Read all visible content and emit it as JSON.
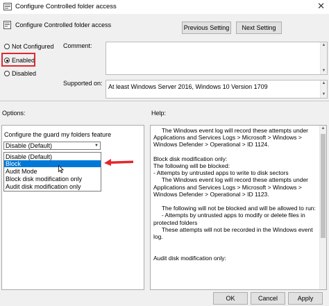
{
  "window": {
    "title": "Configure Controlled folder access",
    "close_glyph": "✕"
  },
  "header": {
    "policy_title": "Configure Controlled folder access",
    "prev_button": "Previous Setting",
    "next_button": "Next Setting"
  },
  "state": {
    "not_configured": "Not Configured",
    "enabled": "Enabled",
    "disabled": "Disabled",
    "selected": "Enabled"
  },
  "comment": {
    "label": "Comment:",
    "value": ""
  },
  "supported": {
    "label": "Supported on:",
    "value": "At least Windows Server 2016, Windows 10 Version 1709"
  },
  "options": {
    "label": "Options:",
    "feature_label": "Configure the guard my folders feature",
    "dropdown_value": "Disable (Default)",
    "dropdown_items": [
      "Disable (Default)",
      "Block",
      "Audit Mode",
      "Block disk modification only",
      "Audit disk modification only"
    ],
    "selected_item": "Block"
  },
  "help": {
    "label": "Help:",
    "text": "     The Windows event log will record these attempts under Applications and Services Logs > Microsoft > Windows > Windows Defender > Operational > ID 1124.\n\nBlock disk modification only:\nThe following will be blocked:\n- Attempts by untrusted apps to write to disk sectors\n     The Windows event log will record these attempts under Applications and Services Logs > Microsoft > Windows > Windows Defender > Operational > ID 1123.\n\n     The following will not be blocked and will be allowed to run:\n     - Attempts by untrusted apps to modify or delete files in protected folders\n     These attempts will not be recorded in the Windows event log.\n\n\nAudit disk modification only:"
  },
  "footer": {
    "ok": "OK",
    "cancel": "Cancel",
    "apply": "Apply"
  },
  "colors": {
    "highlight_red": "#e2282e",
    "selection_blue": "#0078d7"
  }
}
